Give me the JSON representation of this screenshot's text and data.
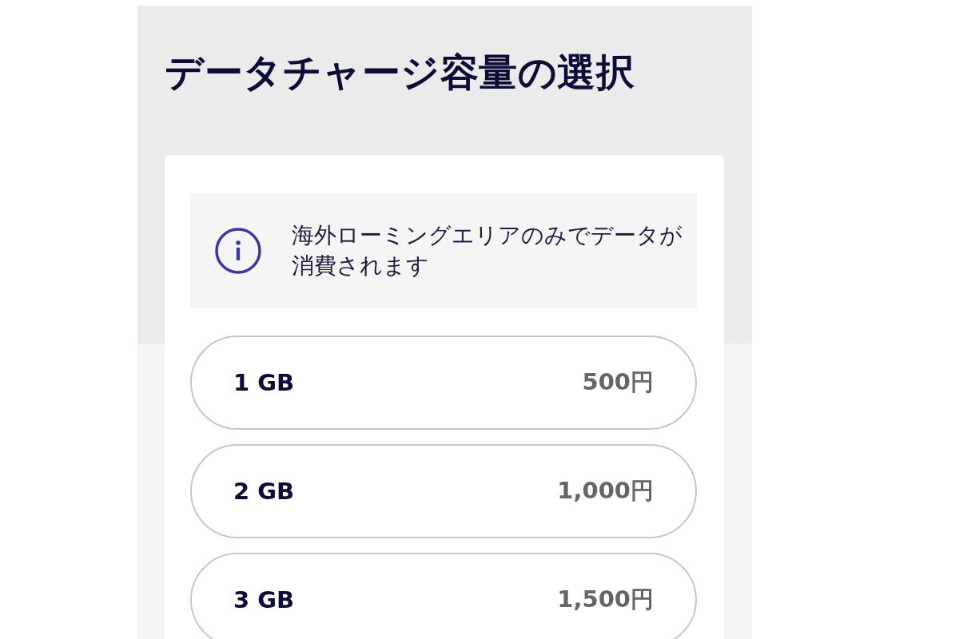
{
  "title": "データチャージ容量の選択",
  "notice": {
    "text": "海外ローミングエリアのみでデータが消費されます"
  },
  "options": [
    {
      "size": "1 GB",
      "price": "500円",
      "selected": false
    },
    {
      "size": "2 GB",
      "price": "1,000円",
      "selected": false
    },
    {
      "size": "3 GB",
      "price": "1,500円",
      "selected": false
    }
  ]
}
